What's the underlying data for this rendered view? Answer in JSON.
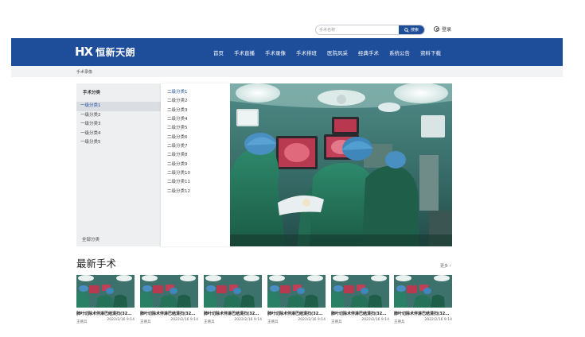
{
  "header": {
    "search_placeholder": "手术名称",
    "search_button": "搜索",
    "login": "登录"
  },
  "brand": {
    "mark": "HX",
    "name": "恒新天朗"
  },
  "nav": [
    "首页",
    "手术直播",
    "手术录像",
    "手术排班",
    "医院风采",
    "经典手术",
    "系统公告",
    "资料下载"
  ],
  "breadcrumb": "手术录像",
  "category": {
    "title": "手术分类",
    "primary": [
      "一级分类1",
      "一级分类2",
      "一级分类3",
      "一级分类4",
      "一级分类5"
    ],
    "all_label": "全部分类",
    "secondary": [
      "二级分类1",
      "二级分类2",
      "二级分类3",
      "二级分类4",
      "二级分类5",
      "二级分类6",
      "二级分类7",
      "二级分类8",
      "二级分类9",
      "二级分类10",
      "二级分类11",
      "二级分类12"
    ]
  },
  "latest": {
    "title": "最新手术",
    "more": "更多 ›",
    "cards": [
      {
        "title": "肺叶切除术伴淋巴结清扫(32…",
        "author": "王德兵",
        "date": "2022/2/16  9:14"
      },
      {
        "title": "肺叶切除术伴淋巴结清扫(32…",
        "author": "王德兵",
        "date": "2022/2/16  9:14"
      },
      {
        "title": "肺叶切除术伴淋巴结清扫(32…",
        "author": "王德兵",
        "date": "2022/2/16  9:14"
      },
      {
        "title": "肺叶切除术伴淋巴结清扫(32…",
        "author": "王德兵",
        "date": "2022/2/16  9:14"
      },
      {
        "title": "肺叶切除术伴淋巴结清扫(32…",
        "author": "王德兵",
        "date": "2022/2/16  9:14"
      },
      {
        "title": "肺叶切除术伴淋巴结清扫(32…",
        "author": "王德兵",
        "date": "2022/2/16  9:14"
      }
    ]
  },
  "colors": {
    "brand_blue": "#1e4e9a",
    "surgical_green": "#2a7a62"
  },
  "icons": {
    "search": "search-icon",
    "user": "user-icon"
  }
}
